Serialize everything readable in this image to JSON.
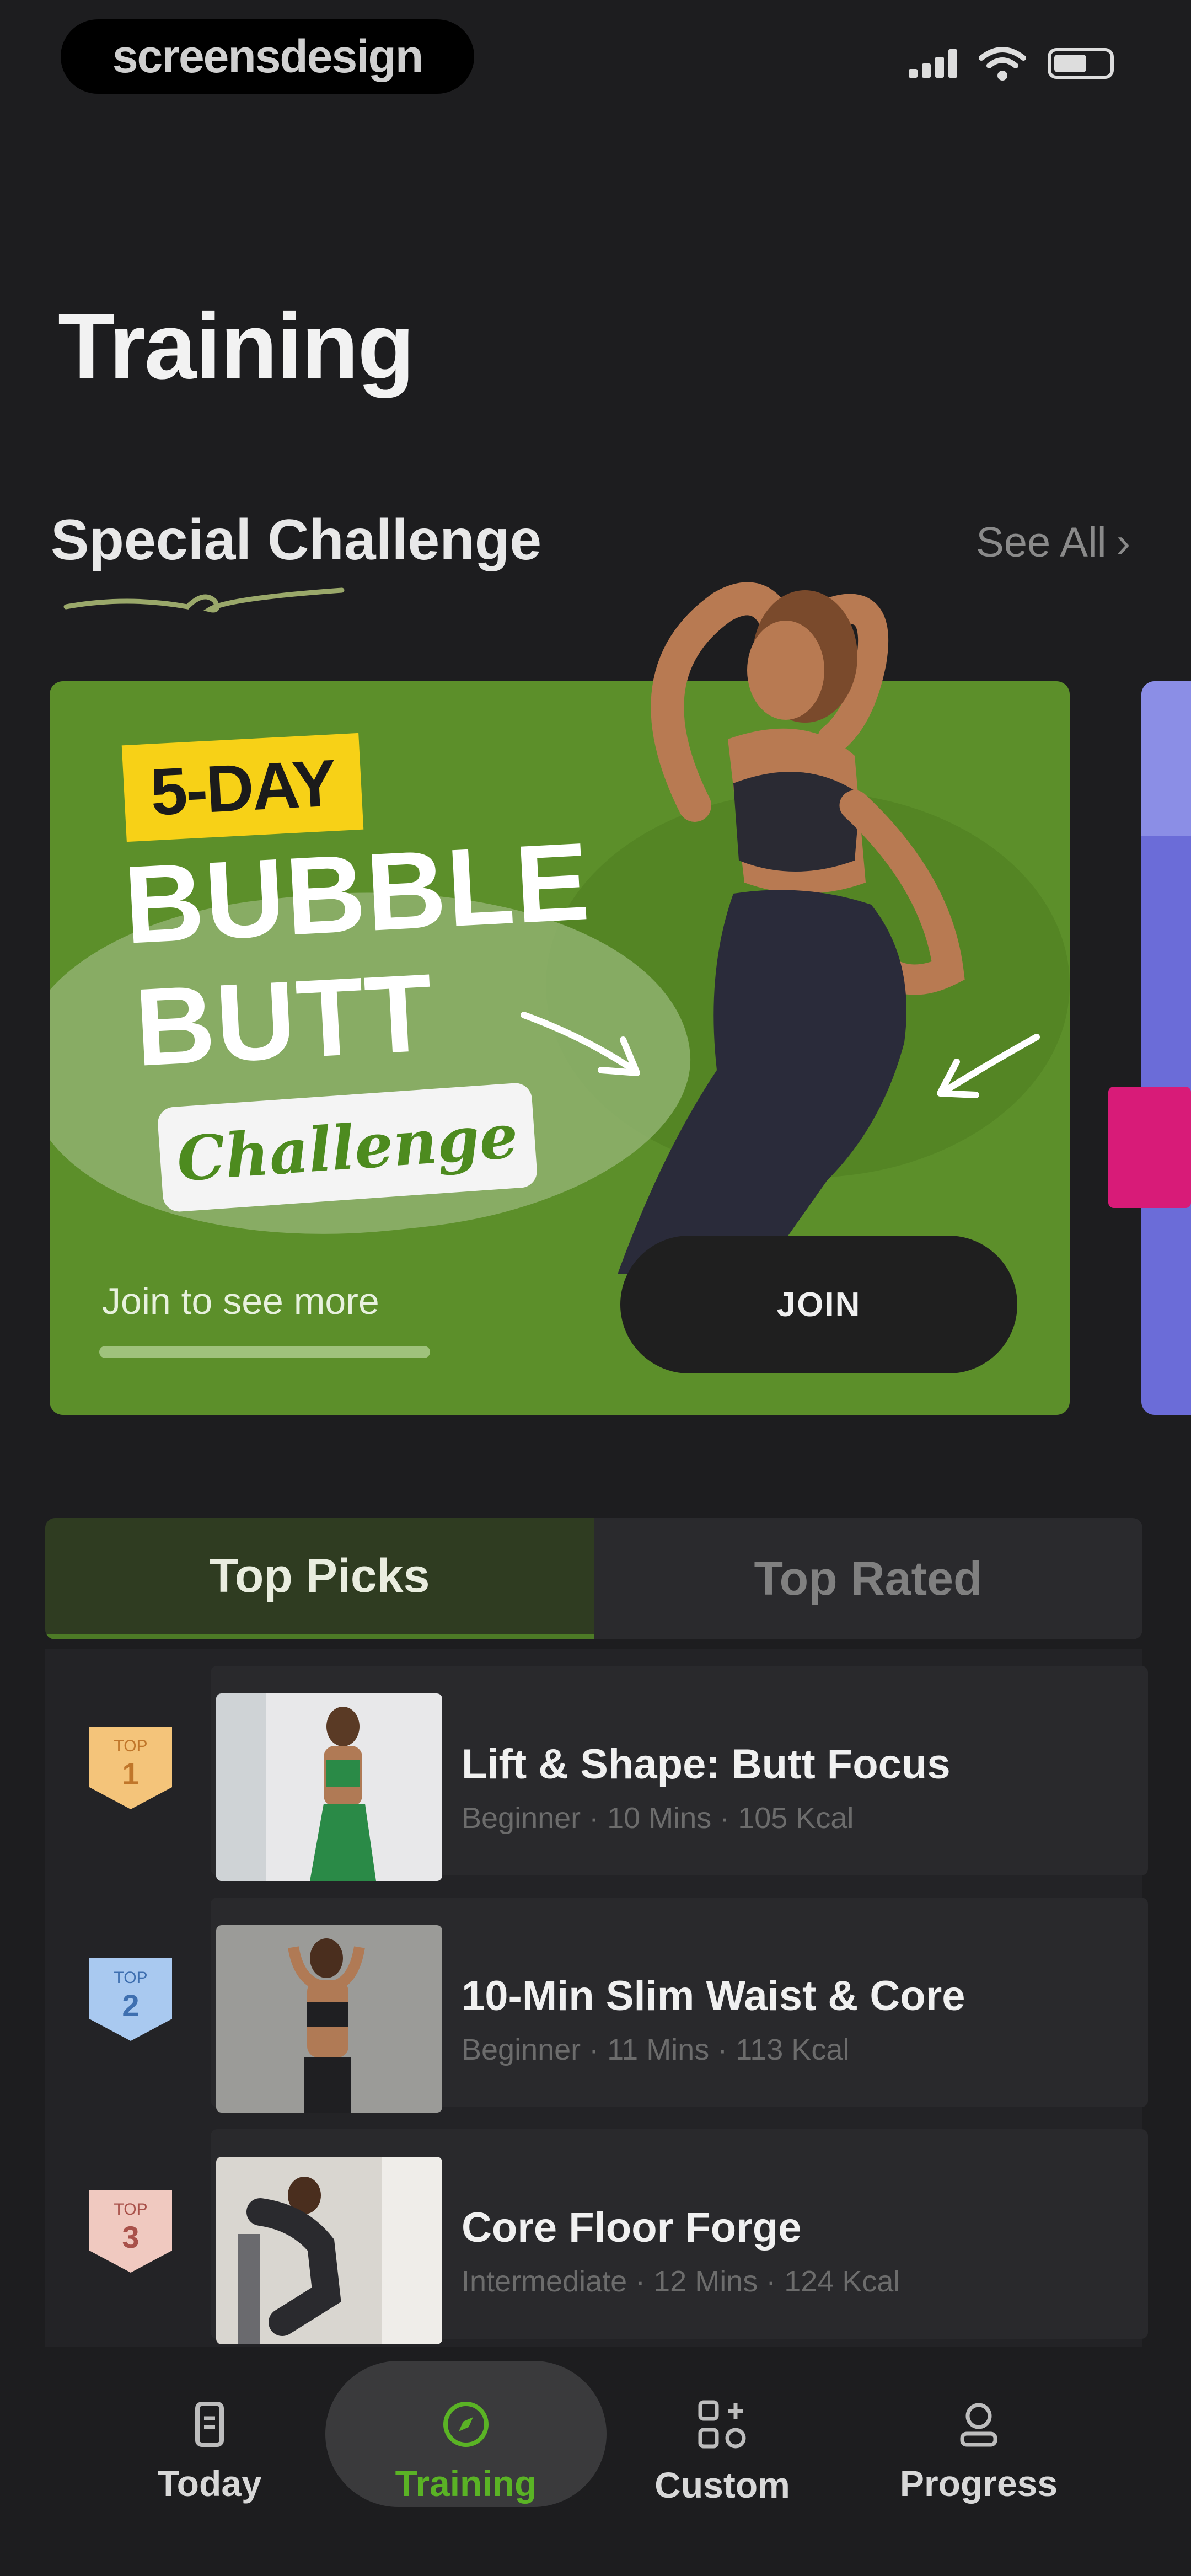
{
  "status_bar": {
    "brand": "screensdesign"
  },
  "page_title": "Training",
  "special": {
    "section_title": "Special Challenge",
    "see_all_label": "See All",
    "banner": {
      "tag": "5-DAY",
      "title_line1": "BUBBLE",
      "title_line2": "BUTT",
      "subtitle": "Challenge",
      "join_more_text": "Join to see more",
      "join_button_label": "JOIN",
      "accent_color": "#5c8f2a",
      "tag_color": "#f7d117"
    }
  },
  "tabs": [
    {
      "label": "Top Picks",
      "active": true
    },
    {
      "label": "Top Rated",
      "active": false
    }
  ],
  "workouts": [
    {
      "rank_label": "TOP",
      "rank": "1",
      "title": "Lift & Shape: Butt Focus",
      "meta": "Beginner · 10 Mins · 105 Kcal",
      "badge_color": "#f4c47a"
    },
    {
      "rank_label": "TOP",
      "rank": "2",
      "title": "10-Min Slim Waist & Core",
      "meta": "Beginner · 11 Mins · 113 Kcal",
      "badge_color": "#a9c9f0"
    },
    {
      "rank_label": "TOP",
      "rank": "3",
      "title": "Core Floor Forge",
      "meta": "Intermediate · 12 Mins · 124 Kcal",
      "badge_color": "#f0c9c0"
    }
  ],
  "bottom_nav": [
    {
      "label": "Today",
      "icon": "today-icon",
      "active": false
    },
    {
      "label": "Training",
      "icon": "compass-icon",
      "active": true
    },
    {
      "label": "Custom",
      "icon": "grid-plus-icon",
      "active": false
    },
    {
      "label": "Progress",
      "icon": "progress-icon",
      "active": false
    }
  ],
  "colors": {
    "background": "#1d1d1f",
    "active_green": "#5ab325",
    "tab_active": "#2f3c21"
  }
}
